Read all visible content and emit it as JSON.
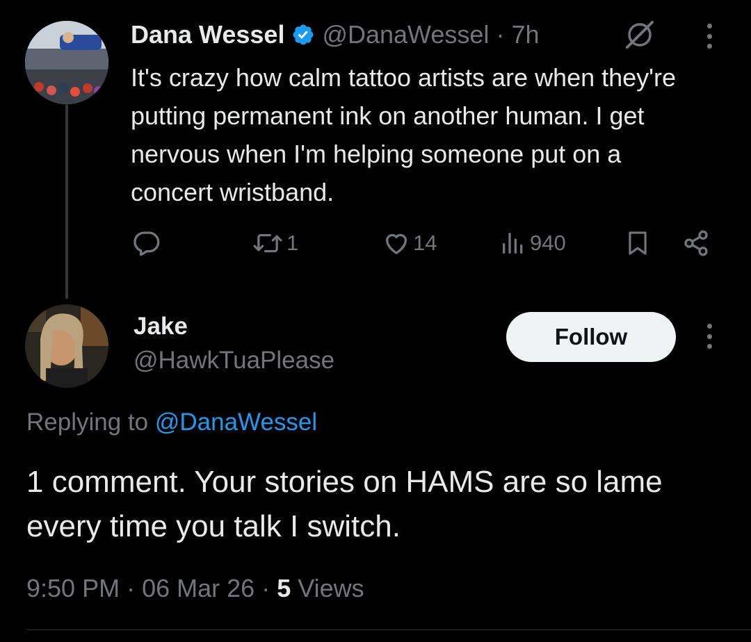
{
  "original_tweet": {
    "author_name": "Dana Wessel",
    "verified": true,
    "handle": "@DanaWessel",
    "separator": "·",
    "time_ago": "7h",
    "text": "It's crazy how calm tattoo artists are when they're putting permanent ink on another human. I get nervous when I'm helping someone put on a concert wristband.",
    "actions": {
      "reply_count": "",
      "retweet_count": "1",
      "like_count": "14",
      "views_count": "940"
    }
  },
  "reply": {
    "author_name": "Jake",
    "handle": "@HawkTuaPlease",
    "follow_label": "Follow",
    "replying_prefix": "Replying to",
    "replying_to": "@DanaWessel",
    "text": "1 comment. Your stories on HAMS are so lame every time you talk I switch.",
    "time": "9:50 PM",
    "date": "06 Mar 26",
    "views_count": "5",
    "views_label": "Views"
  },
  "icons": {
    "verified": "verified-badge-icon",
    "grok": "grok-slash-icon",
    "more": "more-vertical-icon",
    "reply": "reply-bubble-icon",
    "retweet": "retweet-icon",
    "like": "heart-icon",
    "views": "views-bars-icon",
    "bookmark": "bookmark-icon",
    "share": "share-icon"
  },
  "colors": {
    "background": "#000000",
    "primary_text": "#e7e9ea",
    "secondary_text": "#71767b",
    "accent": "#1d9bf0",
    "follow_button_bg": "#eff3f4"
  }
}
